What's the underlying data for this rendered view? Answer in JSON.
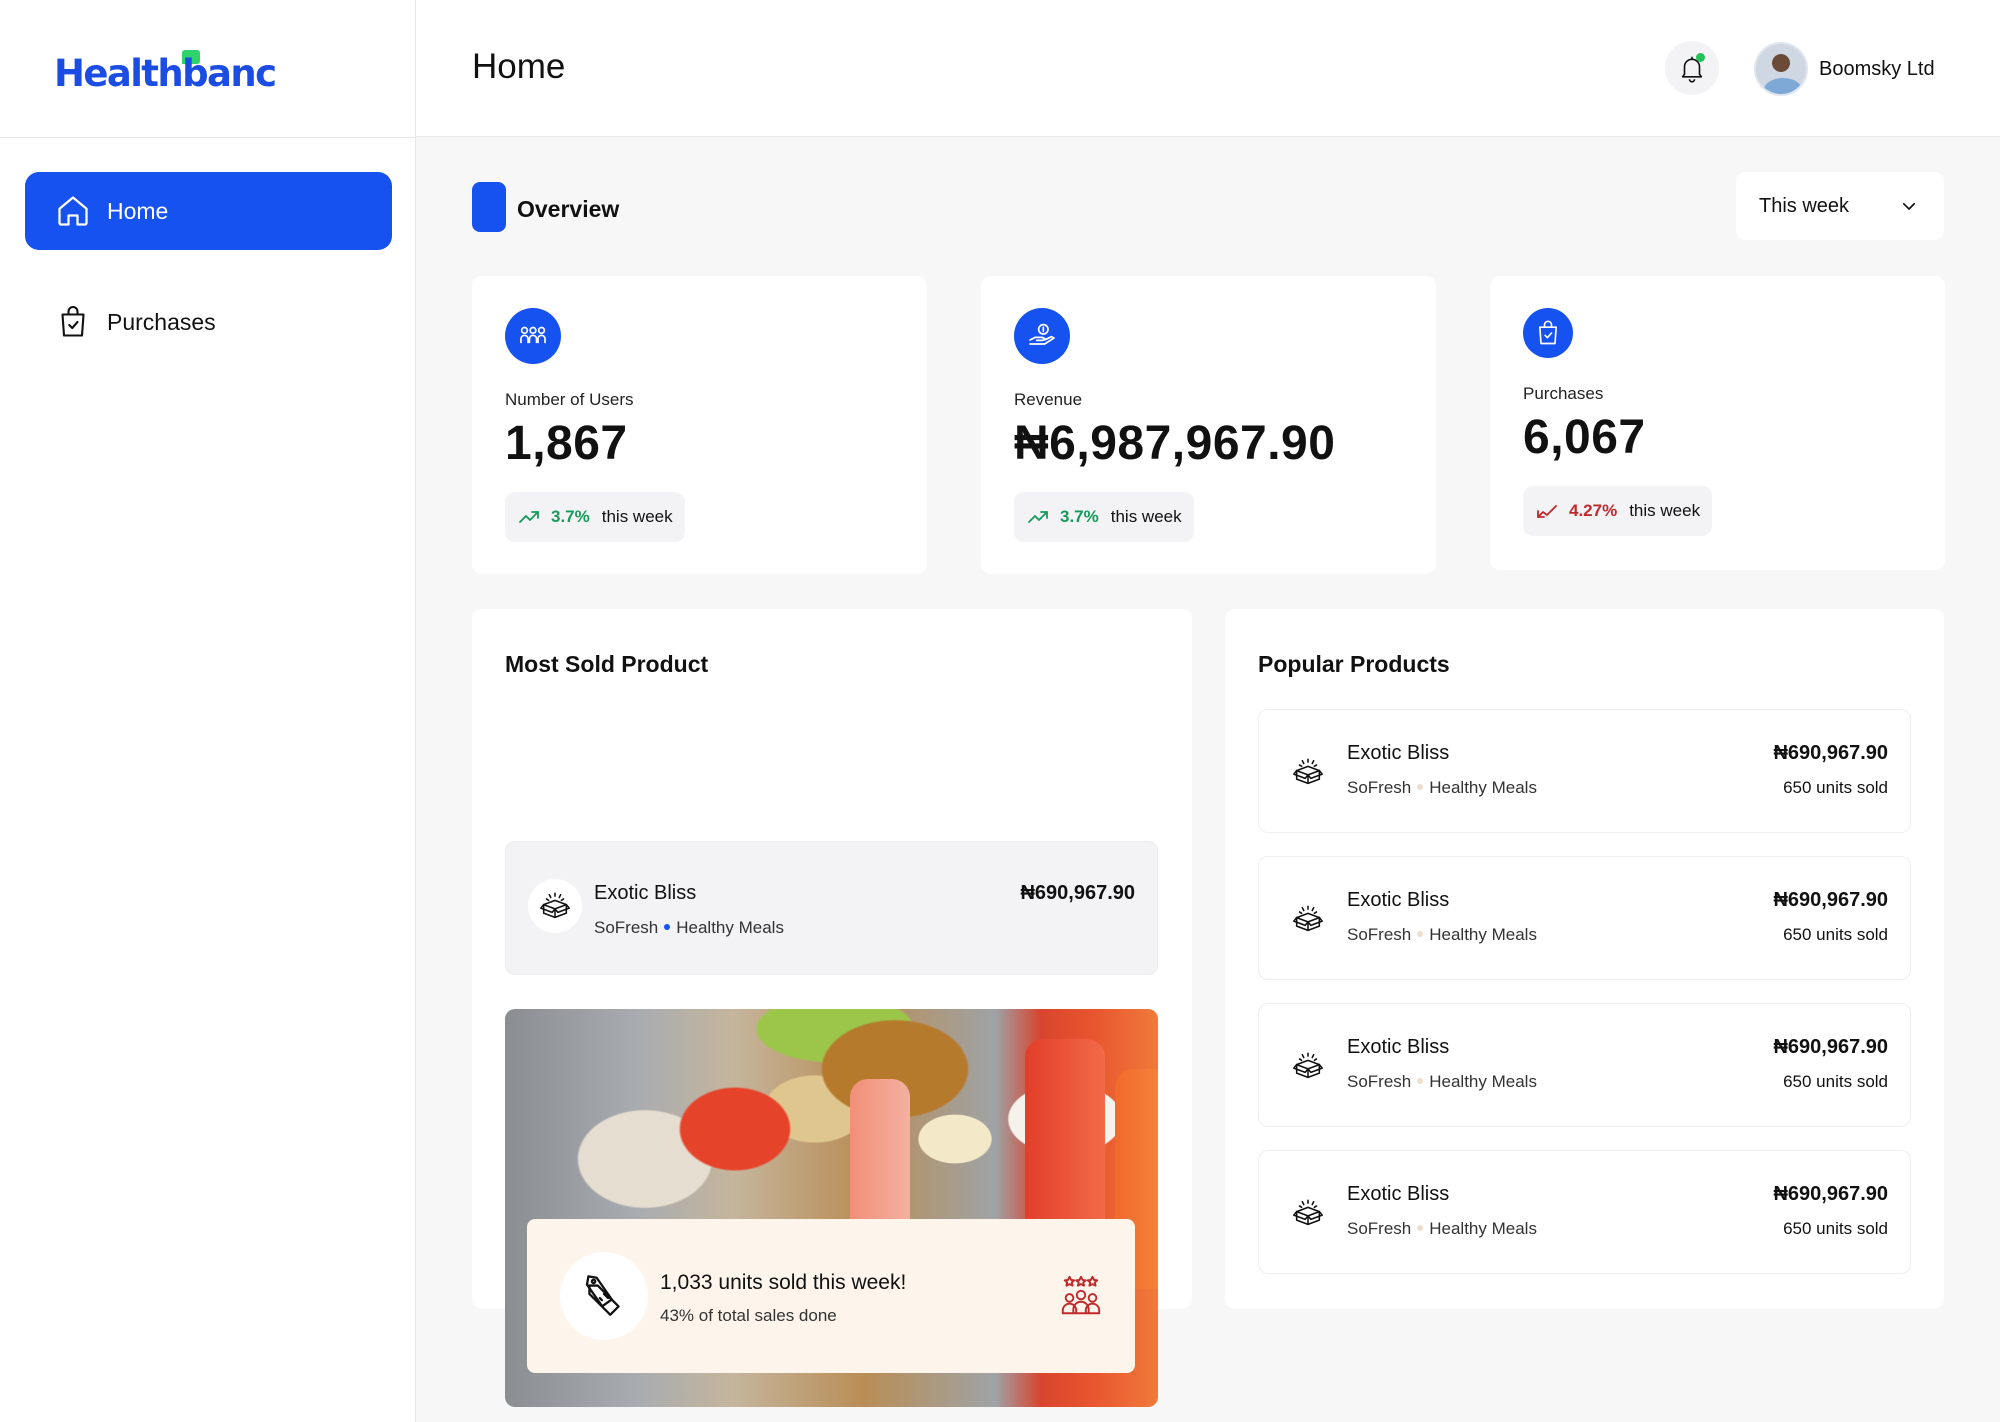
{
  "brand": {
    "name_part1": "Health",
    "name_part2": "banc",
    "accent": "#1652f0",
    "mark_color": "#2fd36b"
  },
  "sidebar": {
    "items": [
      {
        "label": "Home",
        "icon": "home-icon",
        "active": true
      },
      {
        "label": "Purchases",
        "icon": "shopping-bag-icon",
        "active": false
      }
    ]
  },
  "header": {
    "title": "Home",
    "notification_icon": "bell-icon",
    "user": {
      "name": "Boomsky Ltd"
    }
  },
  "overview": {
    "title": "Overview",
    "period": "This week",
    "stats": [
      {
        "label": "Number of Users",
        "value": "1,867",
        "change": "3.7%",
        "direction": "up",
        "suffix": "this week",
        "icon": "users-icon"
      },
      {
        "label": "Revenue",
        "value": "₦6,987,967.90",
        "change": "3.7%",
        "direction": "up",
        "suffix": "this week",
        "icon": "money-hand-icon"
      },
      {
        "label": "Purchases",
        "value": "6,067",
        "change": "4.27%",
        "direction": "down",
        "suffix": "this week",
        "icon": "shopping-bag-icon"
      }
    ]
  },
  "most_sold": {
    "title": "Most Sold Product",
    "product": {
      "name": "Exotic Bliss",
      "vendor": "SoFresh",
      "category": "Healthy Meals",
      "price": "₦690,967.90"
    },
    "highlight": {
      "title": "1,033 units sold this week!",
      "subtitle": "43% of total sales done"
    }
  },
  "popular": {
    "title": "Popular Products",
    "items": [
      {
        "name": "Exotic Bliss",
        "vendor": "SoFresh",
        "category": "Healthy Meals",
        "price": "₦690,967.90",
        "units": "650 units sold"
      },
      {
        "name": "Exotic Bliss",
        "vendor": "SoFresh",
        "category": "Healthy Meals",
        "price": "₦690,967.90",
        "units": "650 units sold"
      },
      {
        "name": "Exotic Bliss",
        "vendor": "SoFresh",
        "category": "Healthy Meals",
        "price": "₦690,967.90",
        "units": "650 units sold"
      },
      {
        "name": "Exotic Bliss",
        "vendor": "SoFresh",
        "category": "Healthy Meals",
        "price": "₦690,967.90",
        "units": "650 units sold"
      }
    ]
  }
}
